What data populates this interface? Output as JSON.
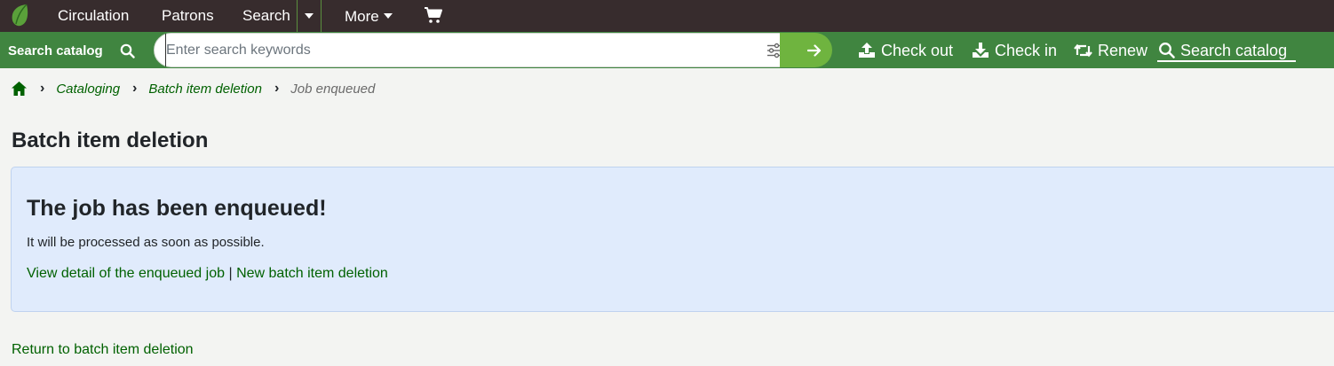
{
  "colors": {
    "top_nav_bg": "#372c2d",
    "search_bar_bg": "#408540",
    "search_go_bg": "#6fb43f",
    "link": "#006100",
    "info_box_bg": "#e0ebfc"
  },
  "top_nav": {
    "logo_icon": "koha-leaf-icon",
    "items": [
      "Circulation",
      "Patrons",
      "Search",
      "More"
    ],
    "search_dropdown_icon": "caret-down-icon",
    "more_caret_icon": "caret-down-icon",
    "cart_icon": "cart-icon"
  },
  "search_bar": {
    "label": "Search catalog",
    "label_icon": "search-icon",
    "placeholder": "Enter search keywords",
    "value": "",
    "options_icon": "sliders-icon",
    "submit_icon": "arrow-right-icon"
  },
  "quick_links": [
    {
      "label": "Check out",
      "icon": "upload-icon"
    },
    {
      "label": "Check in",
      "icon": "download-icon"
    },
    {
      "label": "Renew",
      "icon": "retweet-icon"
    },
    {
      "label": "Search catalog",
      "icon": "search-icon"
    }
  ],
  "breadcrumb": {
    "home_icon": "home-icon",
    "items": [
      "Cataloging",
      "Batch item deletion"
    ],
    "current": "Job enqueued"
  },
  "page": {
    "title": "Batch item deletion",
    "message": {
      "heading": "The job has been enqueued!",
      "text": "It will be processed as soon as possible.",
      "link_detail": "View detail of the enqueued job",
      "separator": "|",
      "link_new": "New batch item deletion"
    },
    "return_link": "Return to batch item deletion"
  }
}
